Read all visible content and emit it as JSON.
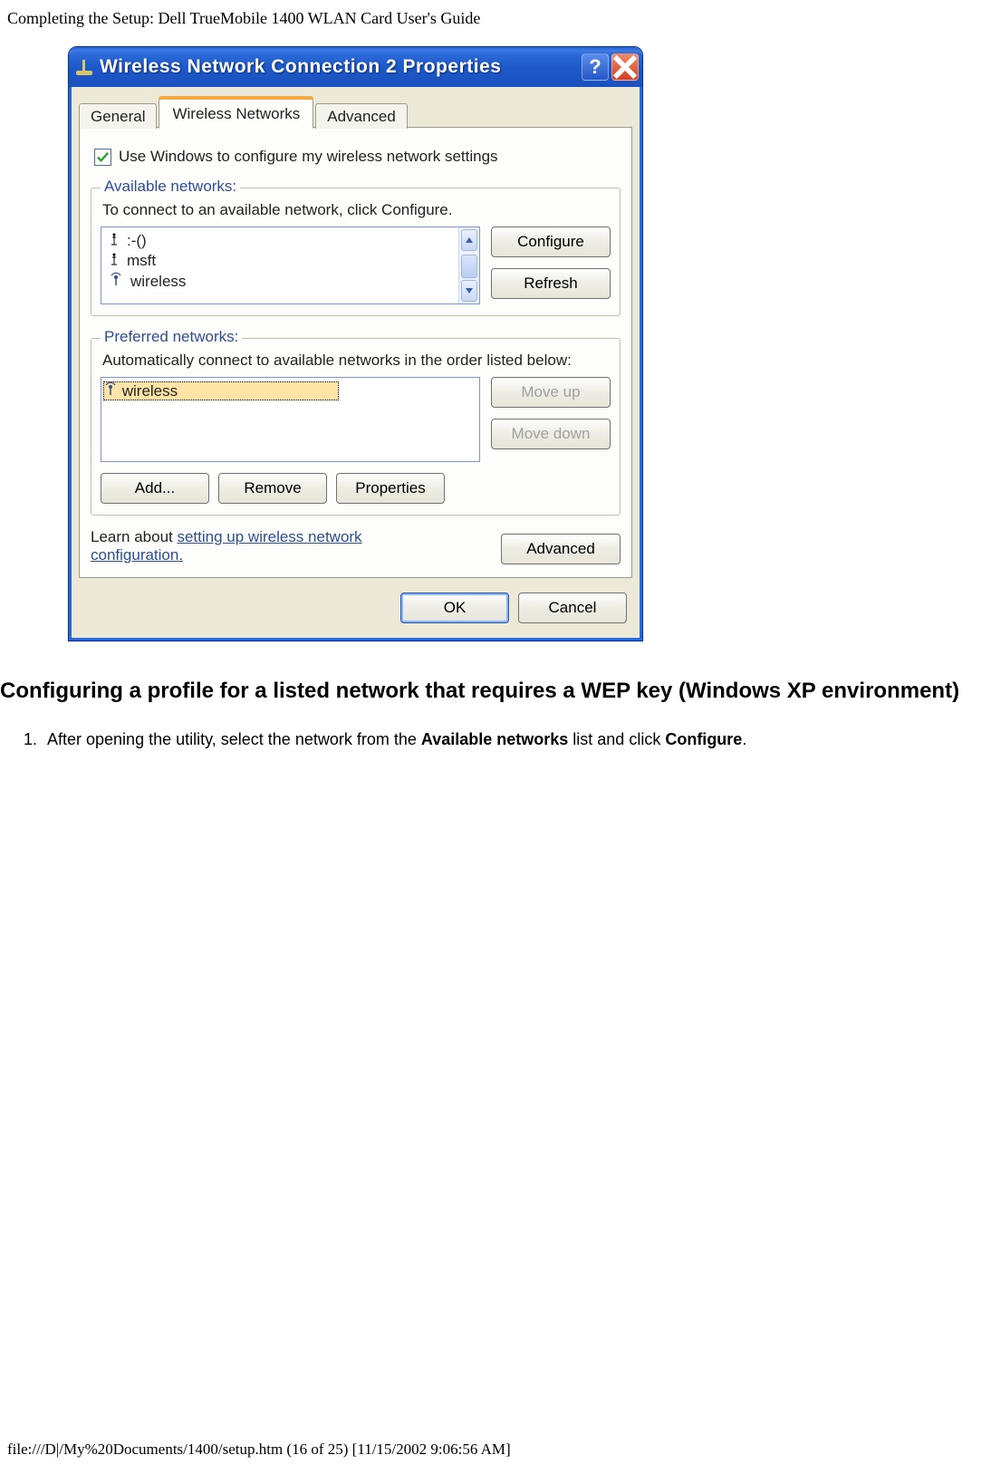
{
  "doc": {
    "header": "Completing the Setup: Dell TrueMobile 1400 WLAN Card User's Guide",
    "footer": "file:///D|/My%20Documents/1400/setup.htm (16 of 25) [11/15/2002 9:06:56 AM]",
    "heading": "Configuring a profile for a listed network that requires a WEP key (Windows XP environment)",
    "step1_prefix": "After opening the utility, select the network from the ",
    "step1_bold1": "Available networks",
    "step1_mid": " list and click ",
    "step1_bold2": "Configure",
    "step1_suffix": "."
  },
  "win": {
    "title": "Wireless Network Connection 2 Properties",
    "tabs": {
      "general": "General",
      "wireless": "Wireless Networks",
      "advanced": "Advanced"
    },
    "use_windows": "Use Windows to configure my wireless network settings",
    "available": {
      "title": "Available networks:",
      "desc": "To connect to an available network, click Configure.",
      "items": [
        ":-()",
        "msft",
        "wireless"
      ],
      "configure": "Configure",
      "refresh": "Refresh"
    },
    "preferred": {
      "title": "Preferred networks:",
      "desc": "Automatically connect to available networks in the order listed below:",
      "item": "wireless",
      "moveup": "Move up",
      "movedown": "Move down",
      "add": "Add...",
      "remove": "Remove",
      "properties": "Properties"
    },
    "learn_prefix": "Learn about ",
    "learn_link": "setting up wireless network configuration.",
    "adv_btn": "Advanced",
    "ok": "OK",
    "cancel": "Cancel"
  }
}
